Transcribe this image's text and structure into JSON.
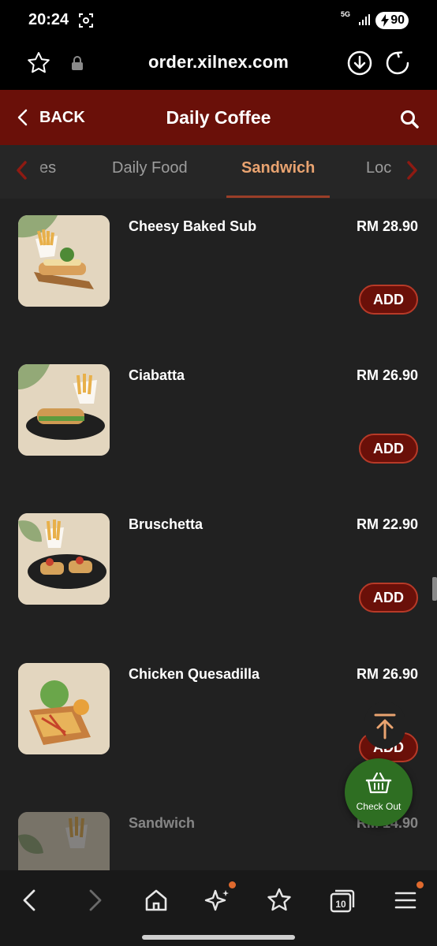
{
  "status_bar": {
    "time": "20:24",
    "network": "5G",
    "battery": "90"
  },
  "browser": {
    "url": "order.xilnex.com"
  },
  "header": {
    "back_label": "BACK",
    "title": "Daily Coffee"
  },
  "tabs": [
    {
      "label": "es"
    },
    {
      "label": "Daily Food"
    },
    {
      "label": "Sandwich"
    },
    {
      "label": "Loc"
    }
  ],
  "products": [
    {
      "name": "Cheesy Baked Sub",
      "price": "RM 28.90",
      "button": "ADD"
    },
    {
      "name": "Ciabatta",
      "price": "RM 26.90",
      "button": "ADD"
    },
    {
      "name": "Bruschetta",
      "price": "RM 22.90",
      "button": "ADD"
    },
    {
      "name": "Chicken Quesadilla",
      "price": "RM 26.90",
      "button": "ADD"
    },
    {
      "name": "Sandwich",
      "price": "RM 14.90"
    }
  ],
  "checkout": {
    "label": "Check Out"
  },
  "bottom_nav": {
    "tabs_count": "10"
  },
  "colors": {
    "brand": "#6a1009",
    "accent": "#e9a370",
    "checkout": "#2e6e22"
  }
}
